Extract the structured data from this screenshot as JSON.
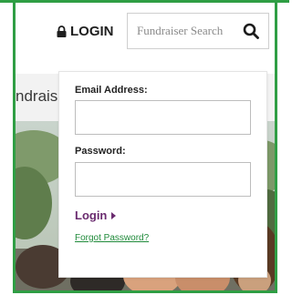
{
  "colors": {
    "frame": "#2f9e44",
    "brand_purple": "#6a2b6f",
    "link_green": "#1f8a3a"
  },
  "header": {
    "login_label": "LOGIN",
    "login_icon": "lock-icon",
    "search": {
      "placeholder": "Fundraiser Search",
      "icon": "search-icon"
    }
  },
  "hero": {
    "title_fragment": "ndraise"
  },
  "login_form": {
    "email_label": "Email Address:",
    "email_value": "",
    "password_label": "Password:",
    "password_value": "",
    "submit_label": "Login",
    "submit_icon": "caret-right-icon",
    "forgot_label": "Forgot Password?"
  }
}
